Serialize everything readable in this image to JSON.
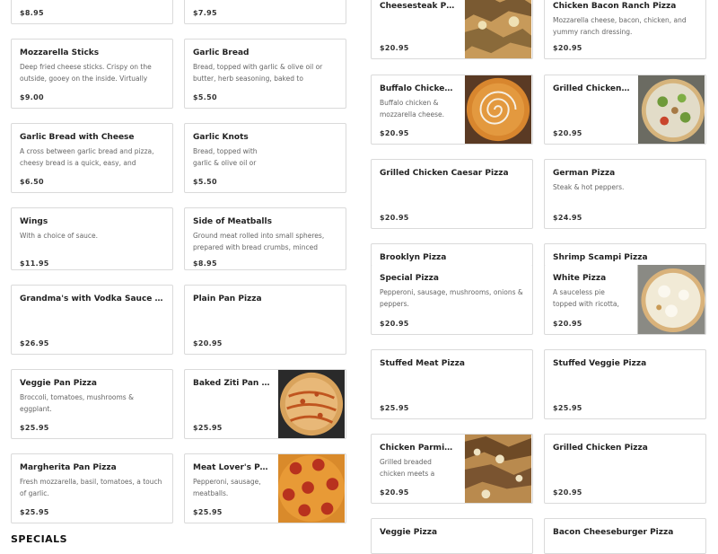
{
  "left_items": {
    "i0": {
      "price": "$8.95"
    },
    "i1": {
      "price": "$7.95"
    },
    "i2": {
      "name": "Mozzarella Sticks",
      "desc": "Deep fried cheese sticks. Crispy on the outside, gooey on the inside. Virtually guaranteed to be …",
      "price": "$9.00"
    },
    "i3": {
      "name": "Garlic Bread",
      "desc": "Bread, topped with garlic & olive oil or butter, herb seasoning, baked to perfection. Melts in…",
      "price": "$5.50"
    },
    "i4": {
      "name": "Garlic Bread with Cheese",
      "desc": "A cross between garlic bread and pizza, cheesy bread is a quick, easy, and delicious party snack.",
      "price": "$6.50"
    },
    "i5": {
      "name": "Garlic Knots",
      "desc": "Bread, topped with garlic & olive oil or butter, herb…",
      "price": "$5.50"
    },
    "i6": {
      "name": "Wings",
      "desc": "With a choice of sauce.",
      "price": "$11.95"
    },
    "i7": {
      "name": "Side of Meatballs",
      "desc": "Ground meat rolled into small spheres, prepared with bread crumbs, minced onion, eggs, butter, …",
      "price": "$8.95"
    },
    "i8": {
      "name": "Grandma's with Vodka Sauce Pizza",
      "price": "$26.95"
    },
    "i9": {
      "name": "Plain Pan Pizza",
      "price": "$20.95"
    },
    "i10": {
      "name": "Veggie Pan Pizza",
      "desc": "Broccoli, tomatoes, mushrooms & eggplant.",
      "price": "$25.95"
    },
    "i11": {
      "name": "Baked Ziti Pan Pizza",
      "price": "$25.95"
    },
    "i12": {
      "name": "Margherita Pan Pizza",
      "desc": "Fresh mozzarella, basil, tomatoes, a touch of garlic.",
      "price": "$25.95"
    },
    "i13": {
      "name": "Meat Lover's Pan Pizza",
      "desc": "Pepperoni, sausage, meatballs.",
      "price": "$25.95"
    }
  },
  "right_items": {
    "r0": {
      "name": "Cheesesteak Pizza",
      "price": "$20.95"
    },
    "r1": {
      "name": "Chicken Bacon Ranch Pizza",
      "desc": "Mozzarella cheese, bacon, chicken, and yummy ranch dressing.",
      "price": "$20.95"
    },
    "r2": {
      "name": "Buffalo Chicken Pizza",
      "desc": "Buffalo chicken & mozzarella cheese.",
      "price": "$20.95"
    },
    "r3": {
      "name": "Grilled Chicken Sala…",
      "price": "$20.95"
    },
    "r4": {
      "name": "Grilled Chicken Caesar Pizza",
      "price": "$20.95"
    },
    "r5": {
      "name": "German Pizza",
      "desc": "Steak & hot peppers.",
      "price": "$24.95"
    },
    "r6": {
      "name": "Brooklyn Pizza"
    },
    "r7": {
      "name": "Shrimp Scampi Pizza"
    },
    "r8": {
      "name": "Special Pizza",
      "desc": "Pepperoni, sausage, mushrooms, onions & peppers.",
      "price": "$20.95"
    },
    "r9": {
      "name": "White Pizza",
      "desc": "A sauceless pie topped with ricotta, mozzarella, …",
      "price": "$20.95"
    },
    "r10": {
      "name": "Stuffed Meat Pizza",
      "price": "$25.95"
    },
    "r11": {
      "name": "Stuffed Veggie Pizza",
      "price": "$25.95"
    },
    "r12": {
      "name": "Chicken Parmigiana…",
      "desc": "Grilled breaded chicken meets a delectable toma…",
      "price": "$20.95"
    },
    "r13": {
      "name": "Grilled Chicken Pizza",
      "price": "$20.95"
    },
    "r14": {
      "name": "Veggie Pizza"
    },
    "r15": {
      "name": "Bacon Cheeseburger Pizza"
    }
  },
  "section": {
    "title": "SPECIALS"
  },
  "colors": {
    "card_border": "#dadada",
    "price_text": "#333333",
    "desc_text": "#666666"
  }
}
